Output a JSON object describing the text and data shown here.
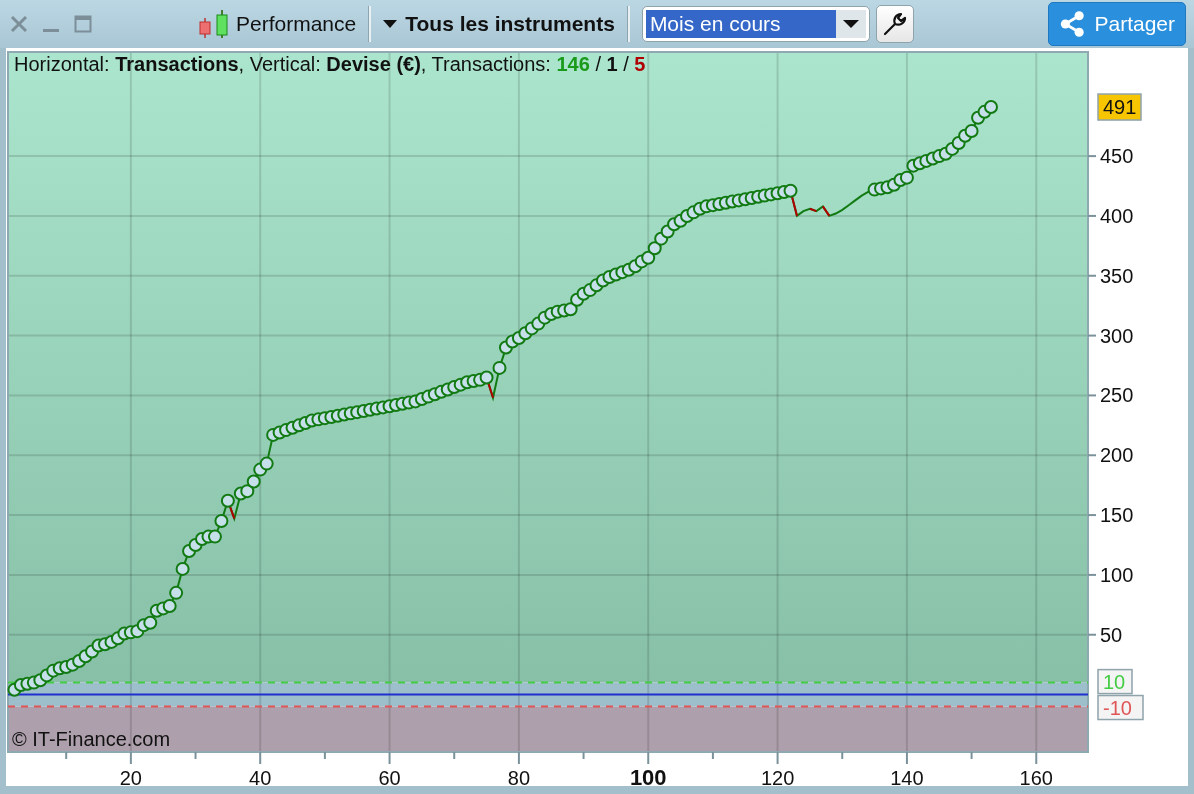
{
  "toolbar": {
    "title": "Performance",
    "instrument_filter": "Tous les instruments",
    "period": {
      "value": "Mois en cours",
      "focused": true
    },
    "share_button": "Partager"
  },
  "chart": {
    "legend": {
      "text": "Horizontal: **Transactions**, Vertical: **Devise (€)**, Transactions:",
      "separator": "/",
      "counts": [
        {
          "text": "146",
          "color": "#1a9a1a"
        },
        {
          "text": "1",
          "color": "#111111"
        },
        {
          "text": "5",
          "color": "#b00000"
        }
      ]
    },
    "copyright": "© IT-Finance.com",
    "chart_data": {
      "type": "line",
      "xlim": [
        1,
        168
      ],
      "ylim": [
        -48,
        537
      ],
      "grid": true,
      "xticks": [
        20,
        40,
        60,
        80,
        {
          "value": 100,
          "label": "100"
        },
        120,
        140,
        160
      ],
      "yticks": [
        50,
        100,
        150,
        200,
        250,
        300,
        350,
        400,
        450
      ],
      "x": [
        2,
        3,
        4,
        5,
        6,
        7,
        8,
        9,
        10,
        11,
        12,
        13,
        14,
        15,
        16,
        17,
        18,
        19,
        20,
        21,
        22,
        23,
        24,
        25,
        26,
        27,
        28,
        29,
        30,
        31,
        32,
        33,
        34,
        35,
        36,
        37,
        38,
        39,
        40,
        41,
        42,
        43,
        44,
        45,
        46,
        47,
        48,
        49,
        50,
        51,
        52,
        53,
        54,
        55,
        56,
        57,
        58,
        59,
        60,
        61,
        62,
        63,
        64,
        65,
        66,
        67,
        68,
        69,
        70,
        71,
        72,
        73,
        74,
        75,
        76,
        77,
        78,
        79,
        80,
        81,
        82,
        83,
        84,
        85,
        86,
        87,
        88,
        89,
        90,
        91,
        92,
        93,
        94,
        95,
        96,
        97,
        98,
        99,
        100,
        101,
        102,
        103,
        104,
        105,
        106,
        107,
        108,
        109,
        110,
        111,
        112,
        113,
        114,
        115,
        116,
        117,
        118,
        119,
        120,
        121,
        122,
        123,
        124,
        125,
        126,
        127,
        128,
        129,
        130,
        131,
        132,
        133,
        134,
        135,
        136,
        137,
        138,
        139,
        140,
        141,
        142,
        143,
        144,
        145,
        146,
        147,
        148,
        149,
        150,
        151,
        152,
        153
      ],
      "series": [
        {
          "color": "#127a12",
          "marker": "o",
          "values": [
            4,
            8,
            9,
            10,
            12,
            16,
            20,
            22,
            23,
            25,
            28,
            32,
            36,
            41,
            42,
            44,
            47,
            51,
            52,
            53,
            58,
            60,
            70,
            72,
            74,
            85,
            105,
            120,
            125,
            130,
            132,
            132,
            145,
            162,
            147,
            168,
            170,
            178,
            188,
            193,
            217,
            219,
            221,
            223,
            225,
            227,
            229,
            230,
            231,
            232,
            233,
            234,
            235,
            236,
            237,
            238,
            239,
            240,
            241,
            242,
            243,
            244,
            245,
            247,
            249,
            251,
            253,
            255,
            257,
            259,
            261,
            262,
            263,
            265,
            248,
            273,
            290,
            295,
            298,
            302,
            306,
            310,
            315,
            318,
            320,
            321,
            322,
            330,
            335,
            338,
            342,
            346,
            349,
            351,
            353,
            355,
            358,
            362,
            365,
            373,
            381,
            387,
            393,
            396,
            400,
            403,
            406,
            408,
            409,
            410,
            411,
            412,
            413,
            414,
            415,
            416,
            417,
            418,
            419,
            420,
            421,
            400,
            404,
            406,
            404,
            408,
            400,
            402,
            405,
            409,
            413,
            417,
            420,
            422,
            423,
            424,
            426,
            430,
            432,
            442,
            444,
            446,
            448,
            450,
            452,
            456,
            461,
            467,
            471,
            482,
            487,
            491
          ]
        }
      ],
      "ref_lines": [
        {
          "axis": "y",
          "value": 10,
          "label": "10",
          "color": "#44cc44"
        },
        {
          "axis": "y",
          "value": 0,
          "color": "#2030d0"
        },
        {
          "axis": "y",
          "value": -10,
          "label": "-10",
          "color": "#e05555"
        }
      ],
      "bands": [
        {
          "axis": "y",
          "from": -10,
          "to": 10,
          "color": "#9dbfcb"
        },
        {
          "axis": "y",
          "from": -48,
          "to": -10,
          "color": "#ad9fab"
        }
      ],
      "annotations": [
        "491"
      ]
    }
  }
}
